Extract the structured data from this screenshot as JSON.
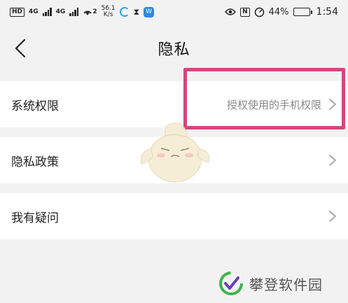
{
  "status_bar": {
    "left_badge": "HD",
    "network_4g_1": "4G",
    "network_4g_2": "4G",
    "hotspot_num": "2",
    "speed_value": "56.1",
    "speed_unit": "K/s",
    "blue_badge": "W",
    "nfc": "N",
    "battery_percent": "44%",
    "battery_level": 0.44,
    "time": "1:54"
  },
  "header": {
    "title": "隐私"
  },
  "rows": [
    {
      "label": "系统权限",
      "value": "授权使用的手机权限"
    },
    {
      "label": "隐私政策",
      "value": ""
    },
    {
      "label": "我有疑问",
      "value": ""
    }
  ],
  "watermark": {
    "text": "攀登软件园"
  },
  "colors": {
    "highlight": "#d6457f",
    "background": "#f2f2f2",
    "row_bg": "#ffffff",
    "value_text": "#8a8a8a"
  }
}
